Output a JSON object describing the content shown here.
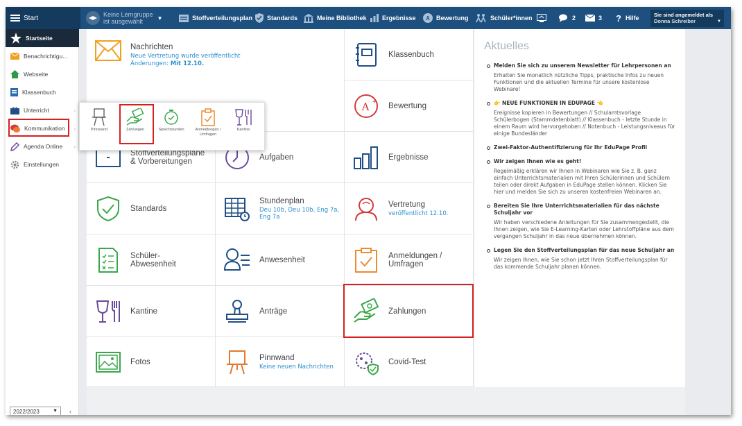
{
  "topbar": {
    "start": "Start",
    "group_line1": "Keine Lerngruppe",
    "group_line2": "ist ausgewählt",
    "items": [
      {
        "label": "Stoffverteilungsplan"
      },
      {
        "label": "Standards"
      },
      {
        "label": "Meine Bibliothek"
      },
      {
        "label": "Ergebnisse"
      },
      {
        "label": "Bewertung"
      },
      {
        "label": "Schüler*innen"
      }
    ],
    "chat_count": "2",
    "mail_count": "3",
    "help": "Hilfe",
    "login_line1": "Sie sind angemeldet als",
    "login_name": "Donna Schreiber"
  },
  "sidebar": {
    "items": [
      {
        "label": "Startseite"
      },
      {
        "label": "Benachrichtigu..."
      },
      {
        "label": "Webseite"
      },
      {
        "label": "Klassenbuch"
      },
      {
        "label": "Unterricht"
      },
      {
        "label": "Kommunikation"
      },
      {
        "label": "Agenda Online"
      },
      {
        "label": "Einstellungen"
      }
    ],
    "year": "2022/2023"
  },
  "popup": {
    "items": [
      {
        "label": "Pinnwand"
      },
      {
        "label": "Zahlungen"
      },
      {
        "label": "Sprechstunden"
      },
      {
        "label": "Anmeldungen / Umfragen"
      },
      {
        "label": "Kantine"
      }
    ]
  },
  "tiles": {
    "nachrichten": {
      "title": "Nachrichten",
      "sub1": "Neue Vertretung wurde veröffentlicht",
      "sub2": "Änderungen:",
      "sub2b": "Mit 12.10."
    },
    "klassenbuch": {
      "title": "Klassenbuch"
    },
    "bewertung": {
      "title": "Bewertung"
    },
    "stoff": {
      "title1": "Stoffverteilungspläne",
      "title2": "& Vorbereitungen"
    },
    "aufgaben": {
      "title": "Aufgaben"
    },
    "ergebnisse": {
      "title": "Ergebnisse"
    },
    "standards": {
      "title": "Standards"
    },
    "stundenplan": {
      "title": "Stundenplan",
      "sub": "Deu 10b, Deu 10b, Eng 7a, Eng 7a"
    },
    "vertretung": {
      "title": "Vertretung",
      "sub": "veröffentlicht 12.10."
    },
    "schueler": {
      "title1": "Schüler-",
      "title2": "Abwesenheit"
    },
    "anwesenheit": {
      "title": "Anwesenheit"
    },
    "anmeldungen": {
      "title1": "Anmeldungen /",
      "title2": "Umfragen"
    },
    "kantine": {
      "title": "Kantine"
    },
    "antraege": {
      "title": "Anträge"
    },
    "zahlungen": {
      "title": "Zahlungen"
    },
    "fotos": {
      "title": "Fotos"
    },
    "pinnwand": {
      "title": "Pinnwand",
      "sub": "Keine neuen Nachrichten"
    },
    "covid": {
      "title": "Covid-Test"
    }
  },
  "news": {
    "heading": "Aktuelles",
    "items": [
      {
        "title": "Melden Sie sich zu unserem Newsletter für Lehrpersonen an",
        "body": "Erhalten Sie monatlich nützliche Tipps, praktische Infos zu neuen Funktionen und die aktuellen Termine für unsere kostenlose Webinare!"
      },
      {
        "title": "👉 NEUE FUNKTIONEN IN EDUPAGE 👈",
        "body": "Ereignisse kopieren in Bewertungen // Schulamtsvorlage Schülerbogen (Stammdatenblatt) // Klassenbuch - letzte Stunde in einem Raum wird hervorgehoben // Notenbuch - Leistungsniveaus für einige Bundesländer"
      },
      {
        "title": "Zwei-Faktor-Authentifizierung für Ihr EduPage Profil",
        "body": ""
      },
      {
        "title": "Wir zeigen Ihnen wie es geht!",
        "body": "Regelmäßig erklären wir Ihnen in Webinaren wie Sie z. B. ganz einfach Unterrichtsmaterialien mit Ihren Schülerinnen und Schülern teilen oder direkt Aufgaben in EduPage stellen können. Klicken Sie hier und melden Sie sich zu unseren kostenfreien Webinaren an."
      },
      {
        "title": "Bereiten Sie Ihre Unterrichtsmaterialien für das nächste Schuljahr vor",
        "body": "Wir haben verschiedene Anleitungen für Sie zusammengestellt, die Ihnen zeigen, wie Sie E-Learning-Karten oder Lehrstoffpläne aus dem vergangen Schuljahr in das neue übernehmen können."
      },
      {
        "title": "Legen Sie den Stoffverteilungsplan für das neue Schuljahr an",
        "body": "Wir zeigen Ihnen, wie Sie schon jetzt Ihren Stoffverteilungsplan für das kommende Schuljahr planen können."
      }
    ]
  },
  "colors": {
    "topbar": "#1d4f7f",
    "accent_orange": "#f0a020",
    "icon_green": "#3aa84a",
    "icon_blue": "#1f4f85",
    "icon_purple": "#6a4a9a",
    "icon_red": "#d43a3a",
    "highlight": "#d42020"
  }
}
